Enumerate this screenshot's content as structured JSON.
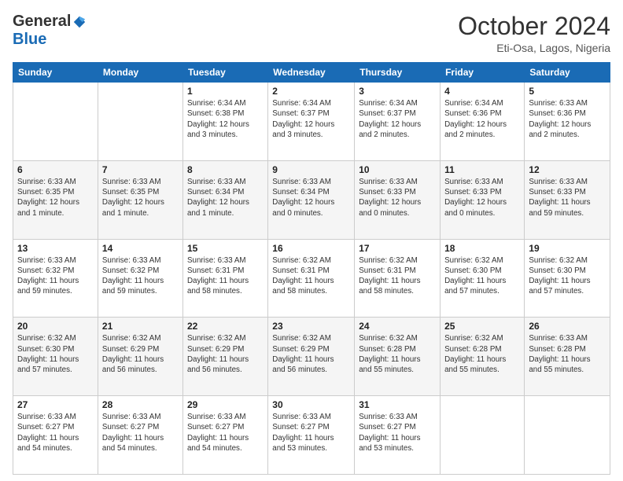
{
  "logo": {
    "general": "General",
    "blue": "Blue"
  },
  "header": {
    "month": "October 2024",
    "location": "Eti-Osa, Lagos, Nigeria"
  },
  "days_of_week": [
    "Sunday",
    "Monday",
    "Tuesday",
    "Wednesday",
    "Thursday",
    "Friday",
    "Saturday"
  ],
  "weeks": [
    [
      {
        "day": "",
        "info": ""
      },
      {
        "day": "",
        "info": ""
      },
      {
        "day": "1",
        "info": "Sunrise: 6:34 AM\nSunset: 6:38 PM\nDaylight: 12 hours\nand 3 minutes."
      },
      {
        "day": "2",
        "info": "Sunrise: 6:34 AM\nSunset: 6:37 PM\nDaylight: 12 hours\nand 3 minutes."
      },
      {
        "day": "3",
        "info": "Sunrise: 6:34 AM\nSunset: 6:37 PM\nDaylight: 12 hours\nand 2 minutes."
      },
      {
        "day": "4",
        "info": "Sunrise: 6:34 AM\nSunset: 6:36 PM\nDaylight: 12 hours\nand 2 minutes."
      },
      {
        "day": "5",
        "info": "Sunrise: 6:33 AM\nSunset: 6:36 PM\nDaylight: 12 hours\nand 2 minutes."
      }
    ],
    [
      {
        "day": "6",
        "info": "Sunrise: 6:33 AM\nSunset: 6:35 PM\nDaylight: 12 hours\nand 1 minute."
      },
      {
        "day": "7",
        "info": "Sunrise: 6:33 AM\nSunset: 6:35 PM\nDaylight: 12 hours\nand 1 minute."
      },
      {
        "day": "8",
        "info": "Sunrise: 6:33 AM\nSunset: 6:34 PM\nDaylight: 12 hours\nand 1 minute."
      },
      {
        "day": "9",
        "info": "Sunrise: 6:33 AM\nSunset: 6:34 PM\nDaylight: 12 hours\nand 0 minutes."
      },
      {
        "day": "10",
        "info": "Sunrise: 6:33 AM\nSunset: 6:33 PM\nDaylight: 12 hours\nand 0 minutes."
      },
      {
        "day": "11",
        "info": "Sunrise: 6:33 AM\nSunset: 6:33 PM\nDaylight: 12 hours\nand 0 minutes."
      },
      {
        "day": "12",
        "info": "Sunrise: 6:33 AM\nSunset: 6:33 PM\nDaylight: 11 hours\nand 59 minutes."
      }
    ],
    [
      {
        "day": "13",
        "info": "Sunrise: 6:33 AM\nSunset: 6:32 PM\nDaylight: 11 hours\nand 59 minutes."
      },
      {
        "day": "14",
        "info": "Sunrise: 6:33 AM\nSunset: 6:32 PM\nDaylight: 11 hours\nand 59 minutes."
      },
      {
        "day": "15",
        "info": "Sunrise: 6:33 AM\nSunset: 6:31 PM\nDaylight: 11 hours\nand 58 minutes."
      },
      {
        "day": "16",
        "info": "Sunrise: 6:32 AM\nSunset: 6:31 PM\nDaylight: 11 hours\nand 58 minutes."
      },
      {
        "day": "17",
        "info": "Sunrise: 6:32 AM\nSunset: 6:31 PM\nDaylight: 11 hours\nand 58 minutes."
      },
      {
        "day": "18",
        "info": "Sunrise: 6:32 AM\nSunset: 6:30 PM\nDaylight: 11 hours\nand 57 minutes."
      },
      {
        "day": "19",
        "info": "Sunrise: 6:32 AM\nSunset: 6:30 PM\nDaylight: 11 hours\nand 57 minutes."
      }
    ],
    [
      {
        "day": "20",
        "info": "Sunrise: 6:32 AM\nSunset: 6:30 PM\nDaylight: 11 hours\nand 57 minutes."
      },
      {
        "day": "21",
        "info": "Sunrise: 6:32 AM\nSunset: 6:29 PM\nDaylight: 11 hours\nand 56 minutes."
      },
      {
        "day": "22",
        "info": "Sunrise: 6:32 AM\nSunset: 6:29 PM\nDaylight: 11 hours\nand 56 minutes."
      },
      {
        "day": "23",
        "info": "Sunrise: 6:32 AM\nSunset: 6:29 PM\nDaylight: 11 hours\nand 56 minutes."
      },
      {
        "day": "24",
        "info": "Sunrise: 6:32 AM\nSunset: 6:28 PM\nDaylight: 11 hours\nand 55 minutes."
      },
      {
        "day": "25",
        "info": "Sunrise: 6:32 AM\nSunset: 6:28 PM\nDaylight: 11 hours\nand 55 minutes."
      },
      {
        "day": "26",
        "info": "Sunrise: 6:33 AM\nSunset: 6:28 PM\nDaylight: 11 hours\nand 55 minutes."
      }
    ],
    [
      {
        "day": "27",
        "info": "Sunrise: 6:33 AM\nSunset: 6:27 PM\nDaylight: 11 hours\nand 54 minutes."
      },
      {
        "day": "28",
        "info": "Sunrise: 6:33 AM\nSunset: 6:27 PM\nDaylight: 11 hours\nand 54 minutes."
      },
      {
        "day": "29",
        "info": "Sunrise: 6:33 AM\nSunset: 6:27 PM\nDaylight: 11 hours\nand 54 minutes."
      },
      {
        "day": "30",
        "info": "Sunrise: 6:33 AM\nSunset: 6:27 PM\nDaylight: 11 hours\nand 53 minutes."
      },
      {
        "day": "31",
        "info": "Sunrise: 6:33 AM\nSunset: 6:27 PM\nDaylight: 11 hours\nand 53 minutes."
      },
      {
        "day": "",
        "info": ""
      },
      {
        "day": "",
        "info": ""
      }
    ]
  ]
}
